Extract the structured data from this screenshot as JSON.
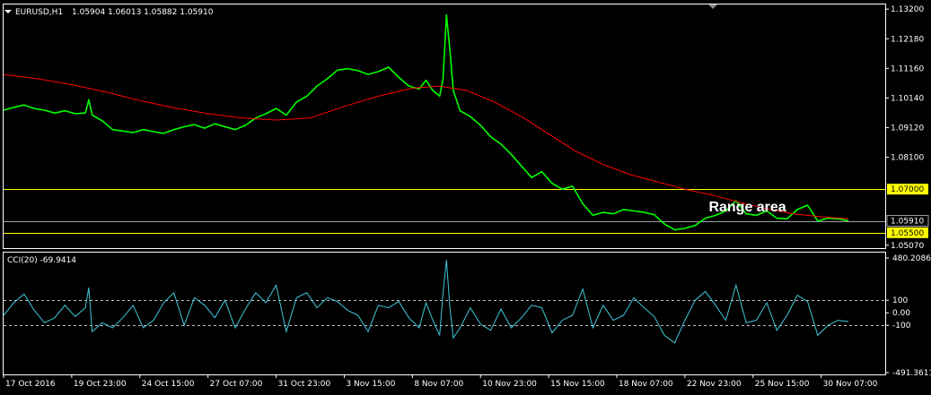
{
  "header": {
    "symbol": "EURUSD,H1",
    "ohlc": "1.05904 1.06013 1.05882 1.05910"
  },
  "indicator": {
    "label": "CCI(20) -69.9414"
  },
  "colors": {
    "background": "#000000",
    "price": "#00ff00",
    "ma": "#ff0000",
    "range": "#ffff00",
    "current": "#9aa0a6",
    "cci": "#40c8d8",
    "frame": "#ffffff",
    "level": "#c0c0c0"
  },
  "chart_data": [
    {
      "type": "line",
      "panel": "price",
      "ylim": [
        1.0497,
        1.1336
      ],
      "y_ticks": [
        "1.13200",
        "1.12180",
        "1.11160",
        "1.10140",
        "1.09120",
        "1.08100",
        "1.05070"
      ],
      "x_ticks": [
        "17 Oct 2016",
        "19 Oct 23:00",
        "24 Oct 15:00",
        "27 Oct 07:00",
        "31 Oct 23:00",
        "3 Nov 15:00",
        "8 Nov 07:00",
        "10 Nov 23:00",
        "15 Nov 15:00",
        "18 Nov 07:00",
        "22 Nov 23:00",
        "25 Nov 15:00",
        "30 Nov 07:00"
      ],
      "x_range": [
        0,
        12.94
      ],
      "series": [
        {
          "role": "price",
          "x": [
            0,
            0.15,
            0.3,
            0.45,
            0.6,
            0.75,
            0.9,
            1.05,
            1.2,
            1.25,
            1.3,
            1.45,
            1.6,
            1.75,
            1.9,
            2.05,
            2.2,
            2.35,
            2.5,
            2.65,
            2.8,
            2.95,
            3.1,
            3.25,
            3.4,
            3.55,
            3.7,
            3.85,
            4.0,
            4.15,
            4.3,
            4.45,
            4.6,
            4.75,
            4.9,
            5.05,
            5.2,
            5.35,
            5.5,
            5.65,
            5.8,
            5.95,
            6.1,
            6.2,
            6.3,
            6.4,
            6.45,
            6.5,
            6.55,
            6.6,
            6.7,
            6.85,
            7.0,
            7.15,
            7.3,
            7.45,
            7.6,
            7.75,
            7.9,
            8.05,
            8.2,
            8.35,
            8.5,
            8.65,
            8.8,
            8.95,
            9.1,
            9.25,
            9.4,
            9.55,
            9.7,
            9.85,
            10.0,
            10.15,
            10.3,
            10.45,
            10.6,
            10.75,
            10.9,
            11.05,
            11.2,
            11.35,
            11.5,
            11.65,
            11.8,
            11.95,
            12.1,
            12.25,
            12.4
          ],
          "values": [
            1.0972,
            1.0982,
            1.099,
            1.0978,
            1.0972,
            1.0962,
            1.097,
            1.096,
            1.0962,
            1.1008,
            1.0955,
            1.0935,
            1.0905,
            1.09,
            1.0895,
            1.0905,
            1.0898,
            1.0892,
            1.0905,
            1.0915,
            1.0922,
            1.091,
            1.0925,
            1.0915,
            1.0905,
            1.092,
            1.0945,
            1.096,
            1.0978,
            1.0955,
            1.1,
            1.102,
            1.1055,
            1.108,
            1.111,
            1.1115,
            1.1108,
            1.1095,
            1.1105,
            1.112,
            1.1085,
            1.1055,
            1.1045,
            1.1075,
            1.104,
            1.102,
            1.108,
            1.13,
            1.118,
            1.104,
            1.097,
            1.095,
            1.092,
            1.088,
            1.0855,
            1.082,
            1.078,
            1.074,
            1.076,
            1.072,
            1.07,
            1.071,
            1.065,
            1.061,
            1.062,
            1.0615,
            1.063,
            1.0625,
            1.062,
            1.0612,
            1.058,
            1.056,
            1.0565,
            1.0575,
            1.06,
            1.061,
            1.0625,
            1.066,
            1.0615,
            1.061,
            1.0625,
            1.06,
            1.0598,
            1.063,
            1.0645,
            1.059,
            1.06,
            1.0598,
            1.0591
          ]
        },
        {
          "role": "moving-average",
          "x": [
            0,
            0.5,
            1.0,
            1.5,
            2.0,
            2.5,
            3.0,
            3.5,
            4.0,
            4.5,
            5.0,
            5.5,
            6.0,
            6.4,
            6.8,
            7.2,
            7.6,
            8.0,
            8.4,
            8.8,
            9.2,
            9.6,
            10.0,
            10.4,
            10.8,
            11.2,
            11.6,
            12.0,
            12.4
          ],
          "values": [
            1.1095,
            1.108,
            1.106,
            1.1035,
            1.1005,
            1.098,
            1.096,
            1.0945,
            1.0938,
            1.0945,
            1.0985,
            1.102,
            1.1048,
            1.1055,
            1.104,
            1.1,
            1.095,
            1.089,
            1.083,
            1.0785,
            1.075,
            1.0725,
            1.07,
            1.068,
            1.0655,
            1.0632,
            1.0615,
            1.0605,
            1.0598
          ]
        }
      ],
      "levels": [
        {
          "name": "range-high",
          "value": 1.07,
          "label": "1.07000"
        },
        {
          "name": "current-price",
          "value": 1.0591,
          "label": "1.05910"
        },
        {
          "name": "range-low",
          "value": 1.055,
          "label": "1.05500"
        }
      ],
      "annotation": {
        "text": "Range area",
        "x": 10.35,
        "y": 1.0624
      }
    },
    {
      "type": "line",
      "panel": "indicator",
      "ylim": [
        -491.3611,
        480.2086
      ],
      "y_ticks": [
        "480.2086",
        "100",
        "0.00",
        "-100",
        "-491.3611"
      ],
      "levels": [
        100,
        -100
      ],
      "series": [
        {
          "role": "cci",
          "x": [
            0,
            0.15,
            0.3,
            0.45,
            0.6,
            0.75,
            0.9,
            1.05,
            1.2,
            1.25,
            1.3,
            1.45,
            1.6,
            1.75,
            1.9,
            2.05,
            2.2,
            2.35,
            2.5,
            2.65,
            2.8,
            2.95,
            3.1,
            3.25,
            3.4,
            3.55,
            3.7,
            3.85,
            4.0,
            4.15,
            4.3,
            4.45,
            4.6,
            4.75,
            4.9,
            5.05,
            5.2,
            5.35,
            5.5,
            5.65,
            5.8,
            5.95,
            6.1,
            6.2,
            6.3,
            6.4,
            6.45,
            6.5,
            6.55,
            6.6,
            6.7,
            6.85,
            7.0,
            7.15,
            7.3,
            7.45,
            7.6,
            7.75,
            7.9,
            8.05,
            8.2,
            8.35,
            8.5,
            8.65,
            8.8,
            8.95,
            9.1,
            9.25,
            9.4,
            9.55,
            9.7,
            9.85,
            10.0,
            10.15,
            10.3,
            10.45,
            10.6,
            10.75,
            10.9,
            11.05,
            11.2,
            11.35,
            11.5,
            11.65,
            11.8,
            11.95,
            12.1,
            12.25,
            12.4
          ],
          "values": [
            -20,
            80,
            150,
            20,
            -80,
            -40,
            60,
            -30,
            40,
            200,
            -150,
            -80,
            -120,
            -40,
            60,
            -120,
            -60,
            80,
            160,
            -100,
            120,
            60,
            -40,
            100,
            -120,
            30,
            160,
            80,
            220,
            -150,
            120,
            160,
            40,
            120,
            90,
            20,
            -20,
            -150,
            60,
            40,
            90,
            -40,
            -120,
            80,
            -60,
            -180,
            160,
            420,
            40,
            -200,
            -120,
            40,
            -90,
            -140,
            30,
            -120,
            -40,
            60,
            40,
            -160,
            -60,
            -20,
            190,
            -120,
            60,
            -60,
            -20,
            120,
            40,
            -30,
            -180,
            -240,
            -60,
            100,
            170,
            60,
            -60,
            220,
            -80,
            -60,
            80,
            -140,
            -20,
            140,
            90,
            -180,
            -100,
            -60,
            -70
          ]
        }
      ]
    }
  ]
}
